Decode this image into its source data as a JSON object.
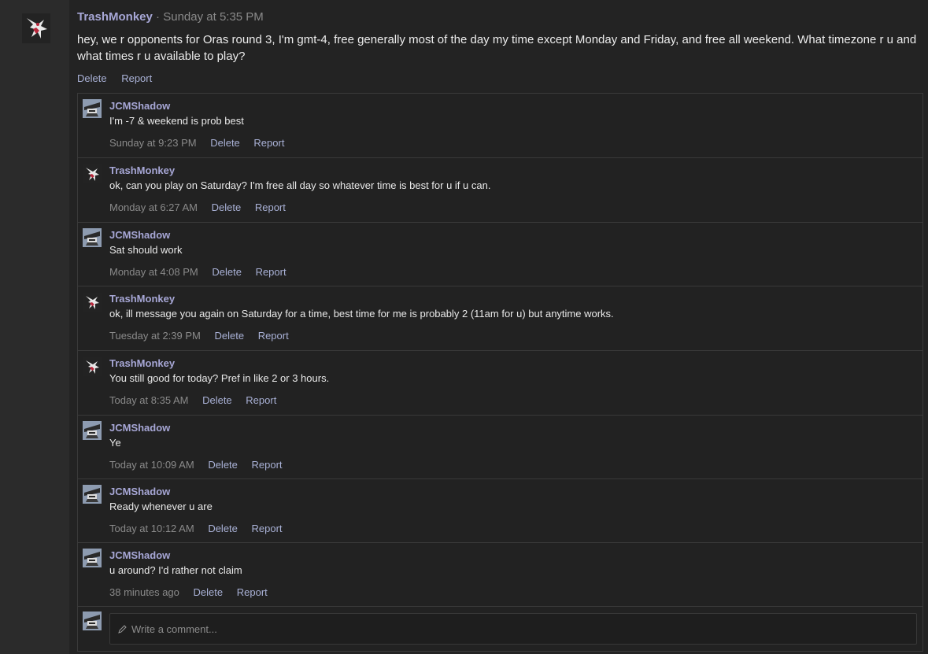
{
  "post": {
    "author": "TrashMonkey",
    "separator": "·",
    "time": "Sunday at 5:35 PM",
    "body": "hey, we r opponents for Oras round 3, I'm gmt-4, free generally most of the day my time except Monday and Friday, and free all weekend. What timezone r u and what times r u available to play?",
    "delete_label": "Delete",
    "report_label": "Report"
  },
  "comments": [
    {
      "author": "JCMShadow",
      "avatar": "ninja-avatar",
      "text": "I'm -7 & weekend is prob best",
      "time": "Sunday at 9:23 PM",
      "delete": "Delete",
      "report": "Report"
    },
    {
      "author": "TrashMonkey",
      "avatar": "monkey-avatar",
      "text": "ok, can you play on Saturday? I'm free all day so whatever time is best for u if u can.",
      "time": "Monday at 6:27 AM",
      "delete": "Delete",
      "report": "Report"
    },
    {
      "author": "JCMShadow",
      "avatar": "ninja-avatar",
      "text": "Sat should work",
      "time": "Monday at 4:08 PM",
      "delete": "Delete",
      "report": "Report"
    },
    {
      "author": "TrashMonkey",
      "avatar": "monkey-avatar",
      "text": "ok, ill message you again on Saturday for a time, best time for me is probably 2 (11am for u) but anytime works.",
      "time": "Tuesday at 2:39 PM",
      "delete": "Delete",
      "report": "Report"
    },
    {
      "author": "TrashMonkey",
      "avatar": "monkey-avatar",
      "text": "You still good for today? Pref in like 2 or 3 hours.",
      "time": "Today at 8:35 AM",
      "delete": "Delete",
      "report": "Report"
    },
    {
      "author": "JCMShadow",
      "avatar": "ninja-avatar",
      "text": "Ye",
      "time": "Today at 10:09 AM",
      "delete": "Delete",
      "report": "Report"
    },
    {
      "author": "JCMShadow",
      "avatar": "ninja-avatar",
      "text": "Ready whenever u are",
      "time": "Today at 10:12 AM",
      "delete": "Delete",
      "report": "Report"
    },
    {
      "author": "JCMShadow",
      "avatar": "ninja-avatar",
      "text": "u around? I'd rather not claim",
      "time": "38 minutes ago",
      "delete": "Delete",
      "report": "Report"
    }
  ],
  "comment_form": {
    "placeholder": "Write a comment...",
    "icon": "pencil-icon"
  },
  "colors": {
    "username": "#a7a7d6",
    "link": "#a9b1d6",
    "meta": "#8a8a8a",
    "background": "#232323"
  }
}
